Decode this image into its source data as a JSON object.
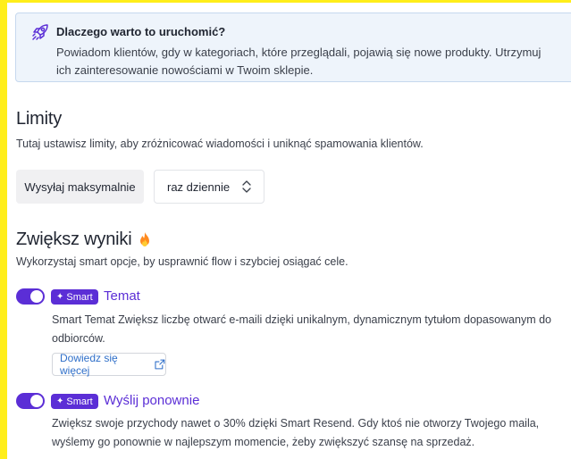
{
  "info": {
    "title": "Dlaczego warto to uruchomić?",
    "text": "Powiadom klientów, gdy w kategoriach, które przeglądali, pojawią się nowe produkty. Utrzymuj ich zainteresowanie nowościami w Twoim sklepie.",
    "icon": "rocket-icon"
  },
  "limits": {
    "heading": "Limity",
    "subtitle": "Tutaj ustawisz limity, aby zróżnicować wiadomości i uniknąć spamowania klientów.",
    "max_button": "Wysyłaj maksymalnie",
    "frequency_value": "raz dziennie"
  },
  "results": {
    "heading": "Zwiększ wyniki",
    "subtitle": "Wykorzystaj smart opcje, by usprawnić flow i szybciej osiągać cele.",
    "features": [
      {
        "enabled": true,
        "badge": "Smart",
        "title": "Temat",
        "description": "Smart Temat Zwiększ liczbę otwarć e-maili dzięki unikalnym, dynamicznym tytułom dopasowanym do odbiorców.",
        "link_label": "Dowiedz się więcej"
      },
      {
        "enabled": true,
        "badge": "Smart",
        "title": "Wyślij ponownie",
        "description": "Zwiększ swoje przychody nawet o 30% dzięki Smart Resend. Gdy ktoś nie otworzy Twojego maila, wyślemy go ponownie w najlepszym momencie, żeby zwiększyć szansę na sprzedaż."
      }
    ]
  },
  "colors": {
    "accent": "#5b2ed6",
    "link": "#2f6fc9",
    "info_bg": "#eef4fb",
    "highlight": "#ffee1a"
  }
}
